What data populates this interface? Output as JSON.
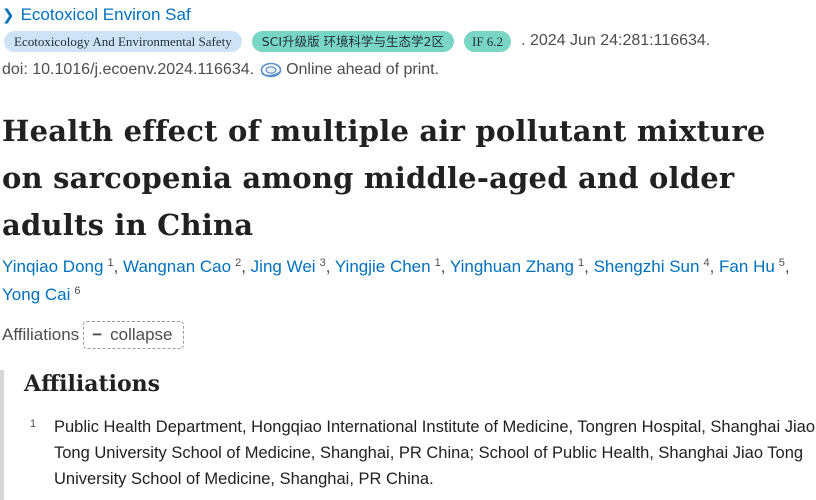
{
  "journal": {
    "link_label": "Ecotoxicol Environ Saf"
  },
  "citation": {
    "journal_badge": "Ecotoxicology And Environmental Safety",
    "sci_badge": "SCI升级版 环境科学与生态学2区",
    "if_badge": "IF 6.2",
    "date_volume": ". 2024 Jun 24:281:116634.",
    "doi": "doi: 10.1016/j.ecoenv.2024.116634.",
    "status": "Online ahead of print."
  },
  "title": "Health effect of multiple air pollutant mixture on sarcopenia among middle-aged and older adults in China",
  "authors": [
    {
      "name": "Yinqiao Dong",
      "sup": "1"
    },
    {
      "name": "Wangnan Cao",
      "sup": "2"
    },
    {
      "name": "Jing Wei",
      "sup": "3"
    },
    {
      "name": "Yingjie Chen",
      "sup": "1"
    },
    {
      "name": "Yinghuan Zhang",
      "sup": "1"
    },
    {
      "name": "Shengzhi Sun",
      "sup": "4"
    },
    {
      "name": "Fan Hu",
      "sup": "5"
    },
    {
      "name": "Yong Cai",
      "sup": "6"
    }
  ],
  "affiliations_toggle": {
    "label": "Affiliations",
    "button": "collapse"
  },
  "affiliations": {
    "heading": "Affiliations",
    "items": [
      {
        "num": "1",
        "text": "Public Health Department, Hongqiao International Institute of Medicine, Tongren Hospital, Shanghai Jiao Tong University School of Medicine, Shanghai, PR China; School of Public Health, Shanghai Jiao Tong University School of Medicine, Shanghai, PR China."
      }
    ]
  },
  "colors": {
    "link": "#0071bc",
    "badge_blue": "#cfe3f7",
    "badge_teal": "#79d6c4"
  },
  "icons": {
    "journal_chevron": "chevron-right-icon",
    "online_status": "online-print-icon"
  }
}
